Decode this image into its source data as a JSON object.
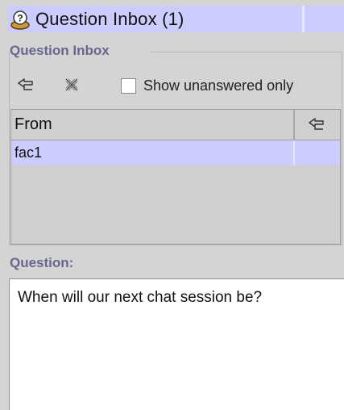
{
  "window": {
    "title": "Question Inbox (1)",
    "icon": "question-inbox-icon",
    "accent_color": "#ccccff"
  },
  "group": {
    "legend": "Question Inbox",
    "legend_color": "#66668f"
  },
  "toolbar": {
    "reply_icon": "reply-arrow-icon",
    "delete_icon": "delete-x-icon",
    "show_unanswered_label": "Show unanswered only",
    "show_unanswered_checked": false
  },
  "table": {
    "columns": [
      {
        "label": "From"
      },
      {
        "label": "",
        "icon": "reply-arrow-icon"
      }
    ],
    "rows": [
      {
        "from": "fac1",
        "selected": true
      }
    ]
  },
  "question": {
    "label": "Question:",
    "text": "When will our next chat session be?"
  }
}
